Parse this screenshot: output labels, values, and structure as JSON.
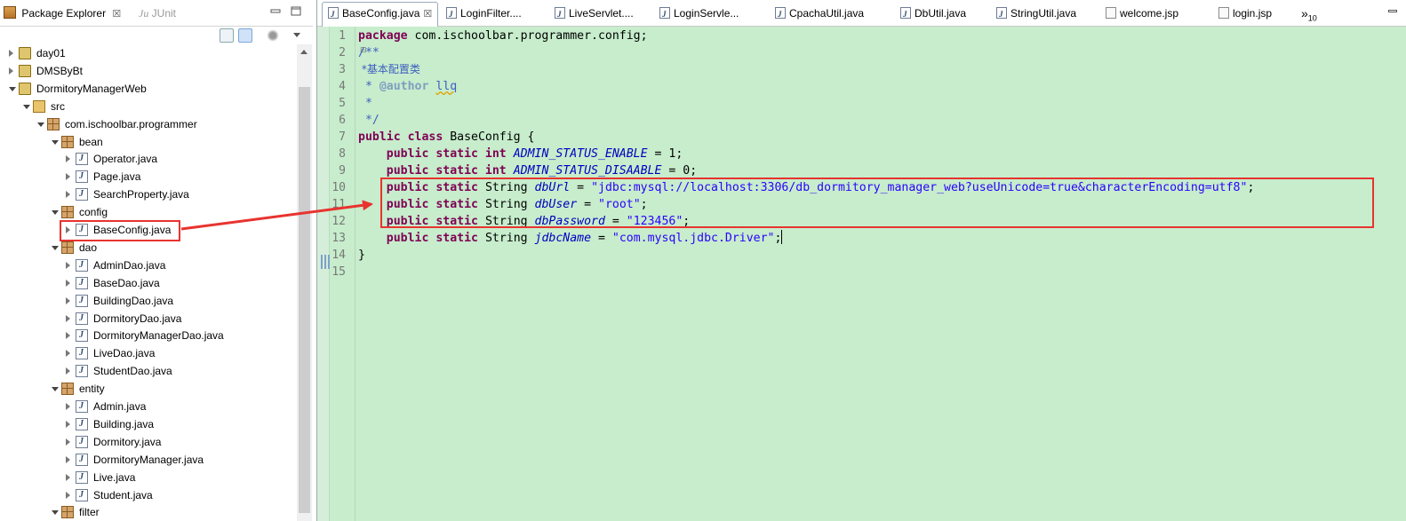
{
  "explorer": {
    "tabs": [
      {
        "label": "Package Explorer",
        "close": "☒"
      },
      {
        "label": "JUnit"
      }
    ],
    "tree": [
      {
        "label": "day01",
        "icon": "project-icon",
        "level": 0,
        "state": "closed"
      },
      {
        "label": "DMSByBt",
        "icon": "project-icon",
        "level": 0,
        "state": "closed"
      },
      {
        "label": "DormitoryManagerWeb",
        "icon": "web-project-icon",
        "level": 0,
        "state": "open"
      },
      {
        "label": "src",
        "icon": "source-folder-icon",
        "level": 1,
        "state": "open"
      },
      {
        "label": "com.ischoolbar.programmer",
        "icon": "package-icon",
        "level": 2,
        "state": "open"
      },
      {
        "label": "bean",
        "icon": "package-icon",
        "level": 3,
        "state": "open"
      },
      {
        "label": "Operator.java",
        "icon": "java-file-icon",
        "level": 4,
        "state": "closed"
      },
      {
        "label": "Page.java",
        "icon": "java-file-icon",
        "level": 4,
        "state": "closed"
      },
      {
        "label": "SearchProperty.java",
        "icon": "java-file-icon",
        "level": 4,
        "state": "closed"
      },
      {
        "label": "config",
        "icon": "package-icon",
        "level": 3,
        "state": "open"
      },
      {
        "label": "BaseConfig.java",
        "icon": "java-file-icon",
        "level": 4,
        "state": "closed"
      },
      {
        "label": "dao",
        "icon": "package-icon",
        "level": 3,
        "state": "open"
      },
      {
        "label": "AdminDao.java",
        "icon": "java-file-icon",
        "level": 4,
        "state": "closed"
      },
      {
        "label": "BaseDao.java",
        "icon": "java-file-icon",
        "level": 4,
        "state": "closed"
      },
      {
        "label": "BuildingDao.java",
        "icon": "java-file-icon",
        "level": 4,
        "state": "closed"
      },
      {
        "label": "DormitoryDao.java",
        "icon": "java-file-icon",
        "level": 4,
        "state": "closed"
      },
      {
        "label": "DormitoryManagerDao.java",
        "icon": "java-file-icon",
        "level": 4,
        "state": "closed"
      },
      {
        "label": "LiveDao.java",
        "icon": "java-file-icon",
        "level": 4,
        "state": "closed"
      },
      {
        "label": "StudentDao.java",
        "icon": "java-file-icon",
        "level": 4,
        "state": "closed"
      },
      {
        "label": "entity",
        "icon": "package-icon",
        "level": 3,
        "state": "open"
      },
      {
        "label": "Admin.java",
        "icon": "java-file-icon",
        "level": 4,
        "state": "closed"
      },
      {
        "label": "Building.java",
        "icon": "java-file-icon",
        "level": 4,
        "state": "closed"
      },
      {
        "label": "Dormitory.java",
        "icon": "java-file-icon",
        "level": 4,
        "state": "closed"
      },
      {
        "label": "DormitoryManager.java",
        "icon": "java-file-icon",
        "level": 4,
        "state": "closed"
      },
      {
        "label": "Live.java",
        "icon": "java-file-icon",
        "level": 4,
        "state": "closed"
      },
      {
        "label": "Student.java",
        "icon": "java-file-icon",
        "level": 4,
        "state": "closed"
      },
      {
        "label": "filter",
        "icon": "package-icon",
        "level": 3,
        "state": "open"
      }
    ]
  },
  "editor": {
    "tabs": [
      {
        "label": "BaseConfig.java",
        "type": "java",
        "active": true,
        "close": "☒"
      },
      {
        "label": "LoginFilter....",
        "type": "java"
      },
      {
        "label": "LiveServlet....",
        "type": "java"
      },
      {
        "label": "LoginServle...",
        "type": "java"
      },
      {
        "label": "CpachaUtil.java",
        "type": "java"
      },
      {
        "label": "DbUtil.java",
        "type": "java"
      },
      {
        "label": "StringUtil.java",
        "type": "java"
      },
      {
        "label": "welcome.jsp",
        "type": "jsp"
      },
      {
        "label": "login.jsp",
        "type": "jsp"
      }
    ],
    "overflow": {
      "label": "»",
      "count": "10"
    },
    "line_numbers": [
      "1",
      "2",
      "3",
      "4",
      "5",
      "6",
      "7",
      "8",
      "9",
      "10",
      "11",
      "12",
      "13",
      "14",
      "15"
    ],
    "code": {
      "l1": {
        "kw": "package",
        "rest": " com.ischoolbar.programmer.config;"
      },
      "l2": "/**",
      "l3": " *基本配置类",
      "l4": {
        "pre": " * ",
        "tag": "@author",
        "sp": " ",
        "name": "llq"
      },
      "l5": " *",
      "l6": " */",
      "l7": {
        "kw": "public class",
        "rest": " BaseConfig {"
      },
      "mods_int": "public static int",
      "mods_str": "public static",
      "type_str": "String",
      "l8": {
        "field": "ADMIN_STATUS_ENABLE",
        "rest": " = 1;"
      },
      "l9": {
        "field": "ADMIN_STATUS_DISAABLE",
        "rest": " = 0;"
      },
      "l10": {
        "field": "dbUrl",
        "eq": " = ",
        "value": "\"jdbc:mysql://localhost:3306/db_dormitory_manager_web?useUnicode=true&characterEncoding=utf8\"",
        "end": ";"
      },
      "l11": {
        "field": "dbUser",
        "eq": " = ",
        "value": "\"root\"",
        "end": ";"
      },
      "l12": {
        "field": "dbPassword",
        "eq": " = ",
        "value": "\"123456\"",
        "end": ";"
      },
      "l13": {
        "field": "jdbcName",
        "eq": " = ",
        "value": "\"com.mysql.jdbc.Driver\"",
        "end": ";"
      },
      "l14": "}"
    }
  },
  "colors": {
    "editor_bg": "#c7edcc",
    "highlight": "#e8332f",
    "keyword": "#7f0055",
    "string": "#2a00ff",
    "field": "#0000c0",
    "comment": "#3f5fbf"
  }
}
